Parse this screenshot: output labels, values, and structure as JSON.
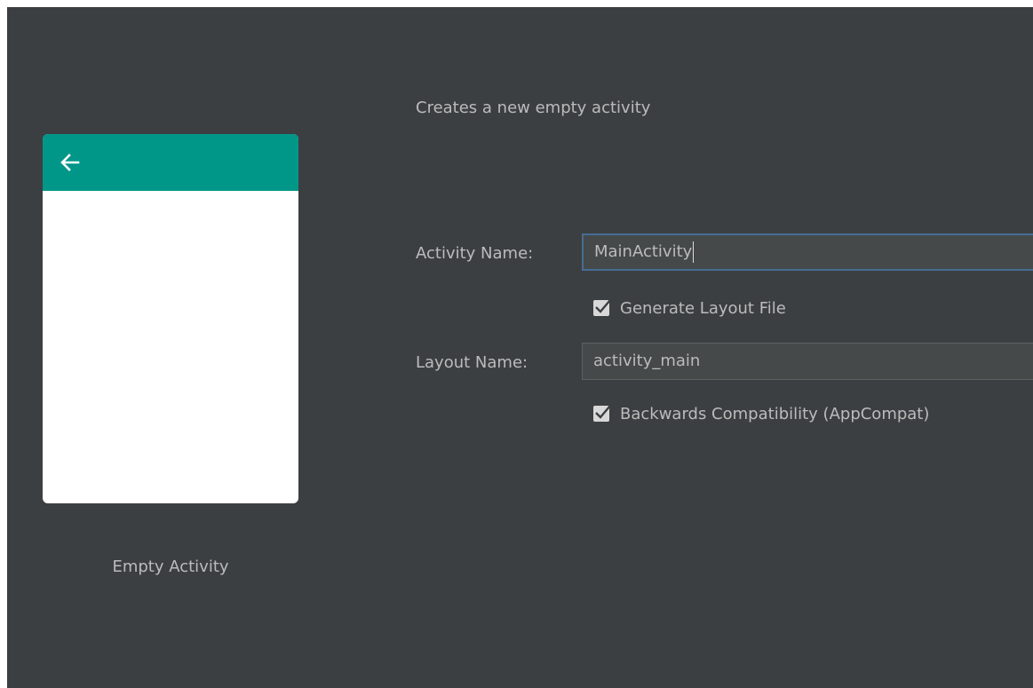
{
  "template": {
    "name": "Empty Activity",
    "preview_bar_color": "#009688",
    "back_icon": "arrow-left-icon"
  },
  "form": {
    "description": "Creates a new empty activity",
    "activity_name": {
      "label": "Activity Name:",
      "value": "MainActivity"
    },
    "generate_layout": {
      "label": "Generate Layout File",
      "checked": true
    },
    "layout_name": {
      "label": "Layout Name:",
      "value": "activity_main"
    },
    "backwards_compat": {
      "label": "Backwards Compatibility (AppCompat)",
      "checked": true
    }
  },
  "colors": {
    "background": "#3c3f41",
    "text": "#bbbbbb",
    "input_bg": "#45494a",
    "focus_border": "#466d94"
  }
}
